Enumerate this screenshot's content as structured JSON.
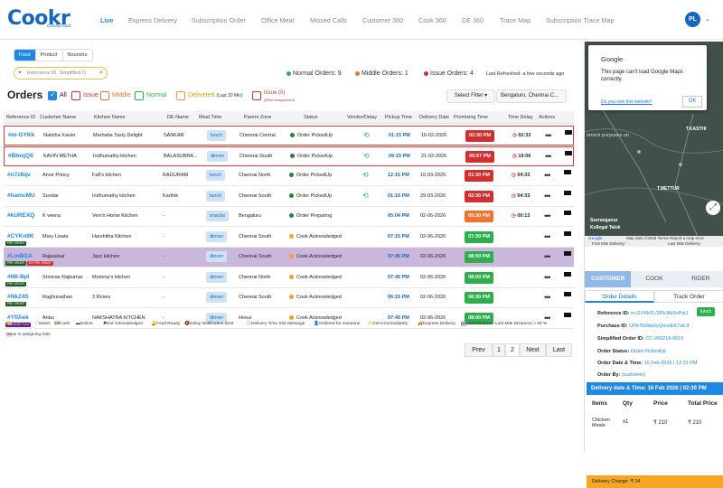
{
  "app": {
    "logo": "Cookr",
    "logo_tagline": "Comfort food",
    "avatar_initials": "PL"
  },
  "nav": [
    {
      "label": "Live",
      "active": true
    },
    {
      "label": "Express Delivery"
    },
    {
      "label": "Subscription Order"
    },
    {
      "label": "Office Meal"
    },
    {
      "label": "Missed Calls"
    },
    {
      "label": "Customer 360"
    },
    {
      "label": "Cook 360"
    },
    {
      "label": "DE 360"
    },
    {
      "label": "Trace Map"
    },
    {
      "label": "Subscription Trace Map"
    }
  ],
  "category_tabs": [
    {
      "label": "Food",
      "active": true
    },
    {
      "label": "Product"
    },
    {
      "label": "Nourisho"
    }
  ],
  "search": {
    "placeholder": "Reference ID, Simplified O"
  },
  "counts": {
    "normal": "Normal Orders: 9",
    "middle": "Middle Orders: 1",
    "issue": "Issue Orders: 4",
    "refreshed": "Last Refreshed: a few seconds ago"
  },
  "orders_filter": {
    "title": "Orders",
    "all": "All",
    "issue": "Issue",
    "middle": "Middle",
    "normal": "Normal",
    "delivered": "Delivered",
    "delivered_sub": "(Last 30 Min)",
    "issue_count": "Issue (0)",
    "issue_sub": "(Rider Assignment)",
    "select_filter": "Select Filter ▾",
    "zone": "Bengaluru, Chennai C..."
  },
  "table": {
    "headers": [
      "Reference ID",
      "Customer Name",
      "Kitchen Name",
      "DE Name",
      "Meal Time",
      "Parent Zone",
      "Status",
      "Vendor/Delay",
      "Pickup Time",
      "Delivery Date",
      "Promising Time",
      "Time Delay",
      "Actions"
    ],
    "rows": [
      {
        "ref": "#m-GYKk",
        "customer": "Natisha Xavier",
        "kitchen": "Marhaba Tasty Delight",
        "de": "SANKAR",
        "meal": "lunch",
        "zone": "Chennai Central",
        "status": "Order PickedUp",
        "status_color": "#2e7d32",
        "pickup": "01:15 PM",
        "date": "16-02-2026",
        "promise": "02:30 PM",
        "promise_color": "#d32f2f",
        "delay": "02:33",
        "delay_color": "#111",
        "tag": "",
        "red_border": true
      },
      {
        "ref": "#BbwjQ6",
        "customer": "KAVIN METHA",
        "kitchen": "Indhumathy kitchen",
        "de": "BALASUBRA...",
        "meal": "dinner",
        "zone": "Chennai South",
        "status": "Order PickedUp",
        "status_color": "#2e7d32",
        "pickup": "09:15 PM",
        "date": "21-02-2026",
        "promise": "09:57 PM",
        "promise_color": "#d32f2f",
        "delay": "19:06",
        "delay_color": "#111",
        "tag": "",
        "red_border": true
      },
      {
        "ref": "#n7z8qv",
        "customer": "Anne Princy",
        "kitchen": "Fafi's kitchen",
        "de": "RAGURAM",
        "meal": "lunch",
        "zone": "Chennai North",
        "status": "Order PickedUp",
        "status_color": "#2e7d32",
        "pickup": "12:15 PM",
        "date": "10-03-2026",
        "promise": "01:30 PM",
        "promise_color": "#d32f2f",
        "delay": "04:33",
        "delay_color": "#111",
        "tag": "",
        "red_border": false
      },
      {
        "ref": "#hamcMU",
        "customer": "Sundar",
        "kitchen": "Indhumathy kitchen",
        "de": "Karthik",
        "meal": "lunch",
        "zone": "Chennai South",
        "status": "Order PickedUp",
        "status_color": "#2e7d32",
        "pickup": "01:15 PM",
        "date": "29-03-2026",
        "promise": "02:30 PM",
        "promise_color": "#d32f2f",
        "delay": "04:33",
        "delay_color": "#111",
        "tag": "",
        "red_border": false
      },
      {
        "ref": "#kUREXQ",
        "customer": "K veena",
        "kitchen": "Veni's Home Kitchen",
        "de": "-",
        "meal": "snacks",
        "zone": "Bengaluru",
        "status": "Order Preparing",
        "status_color": "#2e7d32",
        "pickup": "05:04 PM",
        "date": "02-06-2026",
        "promise": "05:30 PM",
        "promise_color": "#f0742f",
        "delay": "00:13",
        "delay_color": "#111",
        "tag": "",
        "red_border": false
      },
      {
        "ref": "#CYKn9K",
        "customer": "Mary Lisata",
        "kitchen": "Harshitha Kitchen",
        "de": "-",
        "meal": "dinner",
        "zone": "Chennai South",
        "status": "Cook Acknowledged",
        "status_color": "#f0a030",
        "pickup": "07:15 PM",
        "date": "02-06-2026",
        "promise": "07:30 PM",
        "promise_color": "#2eae4e",
        "delay": "",
        "delay_color": "#111",
        "tag": "PRE ORDER",
        "red_border": false
      },
      {
        "ref": "#LmBGA",
        "customer": "Rajasekar",
        "kitchen": "Jazz kitchen",
        "de": "-",
        "meal": "dinner",
        "zone": "Chennai South",
        "status": "Cook Acknowledged",
        "status_color": "#f0a030",
        "pickup": "07:45 PM",
        "date": "02-06-2026",
        "promise": "08:00 PM",
        "promise_color": "#2eae4e",
        "delay": "",
        "delay_color": "#111",
        "tag": "PRE ORDER",
        "red_border": false,
        "purple": true
      },
      {
        "ref": "#N6-Bpl",
        "customer": "Srinivas Rajkumar",
        "kitchen": "Mommy's kitchen",
        "de": "-",
        "meal": "dinner",
        "zone": "Chennai North",
        "status": "Cook Acknowledged",
        "status_color": "#f0a030",
        "pickup": "07:45 PM",
        "date": "02-06-2026",
        "promise": "08:00 PM",
        "promise_color": "#2eae4e",
        "delay": "",
        "delay_color": "#111",
        "tag": "PRE ORDER",
        "red_border": false
      },
      {
        "ref": "#NkZ4S",
        "customer": "Raghunathan",
        "kitchen": "3 Roses",
        "de": "-",
        "meal": "dinner",
        "zone": "Chennai South",
        "status": "Cook Acknowledged",
        "status_color": "#f0a030",
        "pickup": "06:15 PM",
        "date": "02-06-2026",
        "promise": "06:30 PM",
        "promise_color": "#2eae4e",
        "delay": "",
        "delay_color": "#111",
        "tag": "PRE ORDER",
        "red_border": false
      },
      {
        "ref": "#YfIAek",
        "customer": "Anbu",
        "kitchen": "NAKSHATRA KITCHEN",
        "de": "-",
        "meal": "dinner",
        "zone": "Hosur",
        "status": "Cook Acknowledged",
        "status_color": "#f0a030",
        "pickup": "07:45 PM",
        "date": "02-06-2026",
        "promise": "08:00 PM",
        "promise_color": "#2eae4e",
        "delay": "",
        "delay_color": "#111",
        "tag": "SUBSCRIPTION",
        "red_border": false
      }
    ]
  },
  "legend": [
    "Coupons",
    "Notes",
    "Cash",
    "Online",
    "Not Acknowledged",
    "Food Ready",
    "Delay Notification Sent",
    "Delivery Time Slot Message",
    "Ordered for someone",
    "Get-it-immediately",
    "Express Delivery",
    "(Aerial Distance - Last Mile Distance) > 50 %",
    "Issue in assigning rider"
  ],
  "pager": {
    "prev": "Prev",
    "p1": "1",
    "p2": "2",
    "next": "Next",
    "last": "Last"
  },
  "map": {
    "dialog_title": "Google",
    "dialog_msg": "This page can't load Google Maps correctly.",
    "dialog_link": "Do you own this website?",
    "dialog_ok": "OK",
    "labels": [
      "oment purposes on",
      "T.KASTHI",
      "T.METTUR",
      "Seeranganur",
      "Kollegal Taluk",
      "First Mile Delivery:",
      "Last Mile Delivery:"
    ],
    "footer": "Map data ©2026  Terms  Report a map error"
  },
  "panel": {
    "tabs": [
      "CUSTOMER",
      "COOK",
      "RIDER"
    ],
    "subtabs": [
      "Order Details",
      "Track Order"
    ],
    "ref_label": "Reference ID:",
    "ref_val": "m-GYKkTL/2PkJ8z5vPstJ",
    "meal_badge": "lunch",
    "purchase_label": "Purchase ID:",
    "purchase_val": "UPb75iWaXyQonvEK7xb.lf",
    "simplified_label": "Simplified Order ID:",
    "simplified_val": "CC-260216-0015",
    "status_label": "Order Status:",
    "status_val": "Order PickedUp",
    "dt_label": "Order Date & Time:",
    "dt_val": "16 Feb 2026 | 12:31 PM",
    "by_label": "Order By:",
    "by_val": "(customer)",
    "delivery_bar": "Delivery date & Time:  16 Feb 2026 | 02:30 PM",
    "items_headers": [
      "Items",
      "Qty",
      "Price",
      "Total Price"
    ],
    "item_name": "Chicken Meals",
    "item_qty": "x1",
    "item_price": "₹ 210",
    "item_total": "₹ 210",
    "delivery_charge": "Delivery Charge: ₹ 34"
  },
  "colors": {
    "accent": "#1e88e5",
    "normal": "#2eae4e",
    "middle": "#f0742f",
    "issue": "#d32f2f"
  }
}
